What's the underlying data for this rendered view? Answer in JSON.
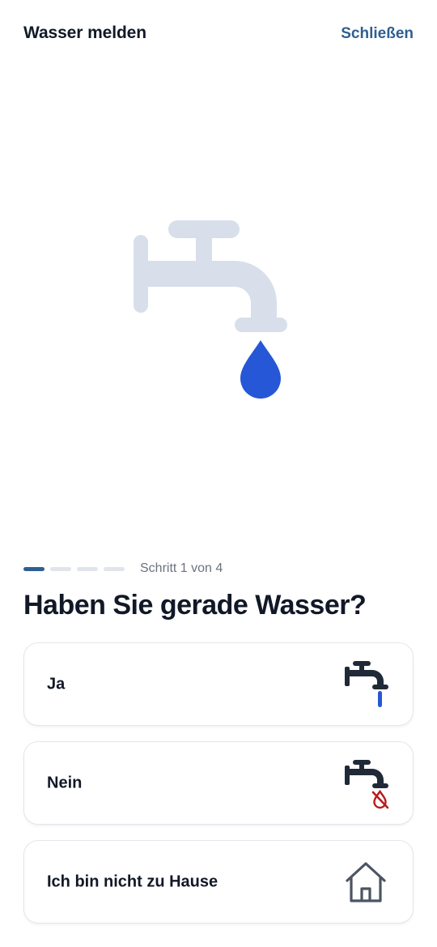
{
  "header": {
    "title": "Wasser melden",
    "close_label": "Schließen"
  },
  "hero": {
    "icon": "faucet-with-drop-icon",
    "faucet_color": "#d8dfeb",
    "drop_color": "#2557d6"
  },
  "progress": {
    "current_step": 1,
    "total_steps": 4,
    "label": "Schritt 1 von 4",
    "active_color": "#2f5f91",
    "inactive_color": "#e1e5eb"
  },
  "question": "Haben Sie gerade Wasser?",
  "options": [
    {
      "label": "Ja",
      "icon": "faucet-running-water-icon"
    },
    {
      "label": "Nein",
      "icon": "faucet-no-water-icon"
    },
    {
      "label": "Ich bin nicht zu Hause",
      "icon": "house-icon"
    }
  ],
  "colors": {
    "accent": "#2f5f91",
    "text": "#111827",
    "water": "#2557d6",
    "no_water": "#b91c1c",
    "icon_dark": "#1f2937",
    "icon_gray": "#4b5563"
  }
}
